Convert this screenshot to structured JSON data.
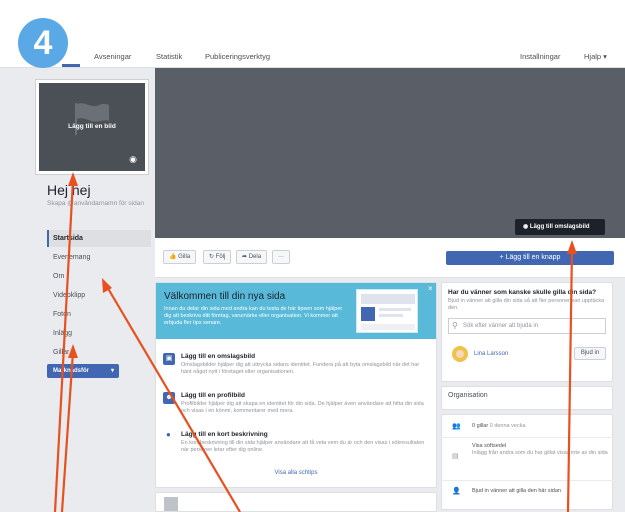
{
  "step": "4",
  "nav": {
    "tabs": [
      "Avseningar",
      "Statistik",
      "Publiceringsverktyg"
    ],
    "right": [
      "Installningar",
      "Hjalp ▾"
    ]
  },
  "profile": {
    "add_photo": "Lägg till en bild"
  },
  "page": {
    "name": "Hej hej",
    "subtitle": "Skapa @användarnamn för sidan"
  },
  "menu": [
    "Startsida",
    "Evenemang",
    "Om",
    "Videoklipp",
    "Foton",
    "Inlägg",
    "Gillar"
  ],
  "promote": {
    "label": "Marknadsför",
    "caret": "▾"
  },
  "cover": {
    "add_cover": "Lägg till omslagsbild"
  },
  "actions": {
    "like": "Gilla",
    "follow": "Följ",
    "share": "Dela",
    "more": "···",
    "cta": "+ Lägg till en knapp"
  },
  "welcome": {
    "title": "Välkommen till din nya sida",
    "text": "Innan du delar din sida med andra kan du testa de här tipsen som hjälper dig att beskriva ditt företag, varumärke eller organisation. Vi kommer att erbjuda fler tips senare.",
    "close": "×",
    "tips": [
      {
        "title": "Lägg till en omslagsbild",
        "body": "Omslagsbilder hjälper dig att uttrycka sidans identitet. Fundera på att byta omslagsbild när det har hänt något nytt i företaget eller organisationen."
      },
      {
        "title": "Lägg till en profilbild",
        "body": "Profilbilder hjälper dig att skapa en identitet för din sida. De hjälper även användare att hitta din sida och visas i en könmi, kommentarer med mera."
      },
      {
        "title": "Lägg till en kort beskrivning",
        "body": "En kort beskrivning till din sida hjälper användare att få veta vem du är och den visas i sökresultaten när personer letar efter dig online."
      }
    ],
    "show_all": "Visa alla schtips"
  },
  "friends": {
    "title": "Har du vänner som kanske skulle gilla din sida?",
    "subtitle": "Bjud in vänner att gilla din sida så att fler personer kan upptäcka den.",
    "search_placeholder": "Sök efter vänner att bjuda in",
    "friend_name": "Lina Larsson",
    "invite": "Bjud in"
  },
  "organisation": "Organisation",
  "stats": [
    {
      "text": "0 gillar",
      "muted": " 0 denna vecka"
    },
    {
      "text": "Visa söftsedel",
      "muted": "Inlägg från andra som du har gillat visas inte av din sida"
    },
    {
      "text": "Bjud in vänner att gilla den här sidan",
      "muted": ""
    }
  ]
}
